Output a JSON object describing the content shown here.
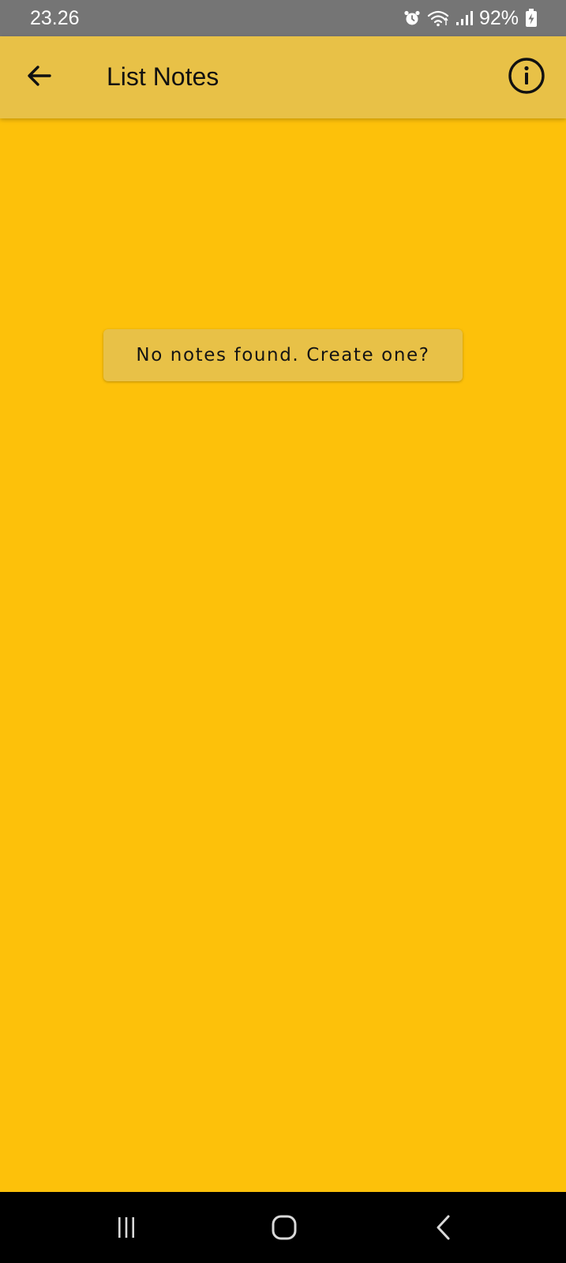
{
  "status_bar": {
    "time": "23.26",
    "battery_percent": "92%",
    "icons": [
      "alarm-icon",
      "wifi-icon",
      "signal-icon",
      "battery-charging-icon"
    ]
  },
  "app_bar": {
    "title": "List Notes",
    "back_icon": "arrow-left-icon",
    "info_icon": "info-circle-icon"
  },
  "main": {
    "empty_message_button": "No notes found. Create one?"
  },
  "nav_bar": {
    "items": [
      "recent-apps-icon",
      "home-icon",
      "back-icon"
    ]
  },
  "colors": {
    "background": "#FDC10A",
    "app_bar": "#E8C147",
    "status_bar": "#757575",
    "nav_bar": "#000000",
    "text": "#111111"
  }
}
